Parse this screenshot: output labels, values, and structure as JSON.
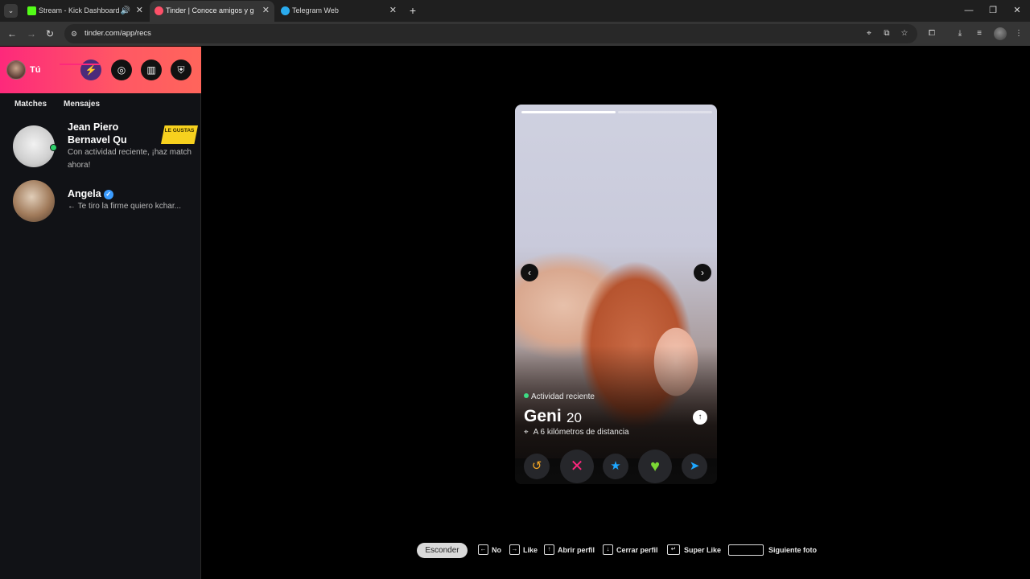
{
  "browser": {
    "tabs": [
      {
        "label": "Stream - Kick Dashboard",
        "favicon_color": "#53fc18",
        "active": false
      },
      {
        "label": "Tinder | Conoce amigos y gent",
        "favicon_color": "#fd5068",
        "active": true
      },
      {
        "label": "Telegram Web",
        "favicon_color": "#2aabee",
        "active": false
      }
    ],
    "url": "tinder.com/app/recs"
  },
  "sidebar": {
    "user_name": "Tú",
    "tabs": {
      "matches": "Matches",
      "messages": "Mensajes"
    },
    "conversations": [
      {
        "name": "Jean Piero Bernavel Qu",
        "message": "Con actividad reciente, ¡haz match ahora!",
        "badge": "LE GUSTAS",
        "online": true
      },
      {
        "name": "Angela",
        "verified": true,
        "message": "← Te tiro la firme quiero kchar..."
      }
    ]
  },
  "profile": {
    "activity": "Actividad reciente",
    "name": "Geni",
    "age": "20",
    "distance": "A 6 kilómetros de distancia",
    "photo_count": 2,
    "current_photo": 1
  },
  "actions": [
    {
      "name": "rewind",
      "icon": "rewind-icon",
      "color": "#f5a623"
    },
    {
      "name": "nope",
      "icon": "close-icon",
      "color": "#fd267d"
    },
    {
      "name": "super-like",
      "icon": "star-icon",
      "color": "#1ea7ff"
    },
    {
      "name": "like",
      "icon": "heart-icon",
      "color": "#7bd834"
    },
    {
      "name": "boost",
      "icon": "send-icon",
      "color": "#1ea7ff"
    }
  ],
  "shortcuts": {
    "hide": "Esconder",
    "no": "No",
    "like": "Like",
    "open_profile": "Abrir perfil",
    "close_profile": "Cerrar perfil",
    "super_like": "Super Like",
    "next_photo": "Siguiente foto"
  },
  "colors": {
    "brand_gradient_start": "#fd297b",
    "brand_gradient_end": "#ff655b",
    "online": "#2fd06b",
    "badge": "#f7d11e"
  }
}
